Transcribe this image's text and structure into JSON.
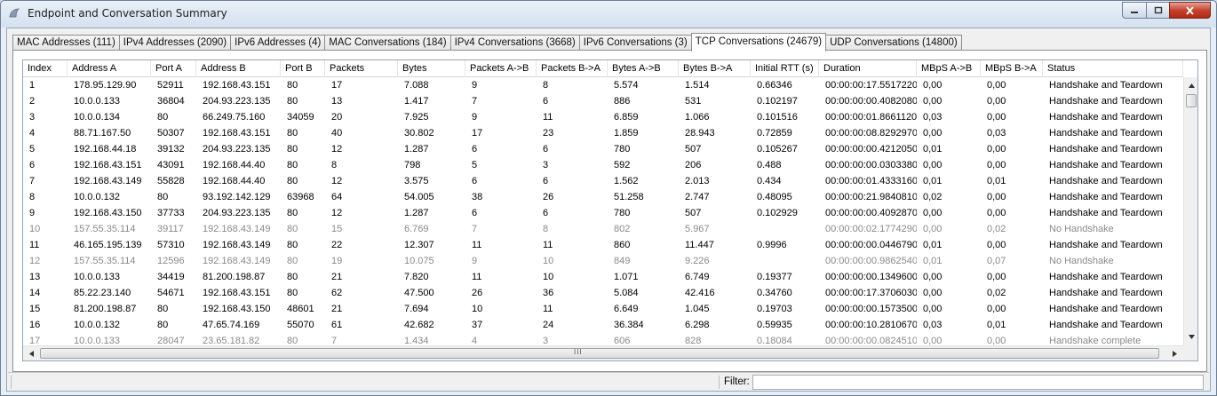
{
  "window": {
    "title": "Endpoint and Conversation Summary"
  },
  "tabs": [
    {
      "label": "MAC Addresses (111)",
      "w": 118
    },
    {
      "label": "IPv4 Addresses (2090)",
      "w": 124
    },
    {
      "label": "IPv6 Addresses (4)",
      "w": 102
    },
    {
      "label": "MAC Conversations (184)",
      "w": 136
    },
    {
      "label": "IPv4 Conversations (3668)",
      "w": 141
    },
    {
      "label": "IPv6 Conversations (3)",
      "w": 123
    },
    {
      "label": "TCP Conversations (24679)",
      "w": 148,
      "active": true
    },
    {
      "label": "UDP Conversations (14800)",
      "w": 140
    }
  ],
  "table": {
    "columns": [
      "Index",
      "Address A",
      "Port A",
      "Address B",
      "Port B",
      "Packets",
      "Bytes",
      "Packets A->B",
      "Packets B->A",
      "Bytes A->B",
      "Bytes B->A",
      "Initial RTT (s)",
      "Duration",
      "MBpS A->B",
      "MBpS B->A",
      "Status"
    ],
    "rows": [
      {
        "cells": [
          "1",
          "178.95.129.90",
          "52911",
          "192.168.43.151",
          "80",
          "17",
          "7.088",
          "9",
          "8",
          "5.574",
          "1.514",
          "0.66346",
          "00:00:00:17.551722000",
          "0,00",
          "0,00",
          "Handshake and Teardown"
        ]
      },
      {
        "cells": [
          "2",
          "10.0.0.133",
          "36804",
          "204.93.223.135",
          "80",
          "13",
          "1.417",
          "7",
          "6",
          "886",
          "531",
          "0.102197",
          "00:00:00:00.408208000",
          "0,00",
          "0,00",
          "Handshake and Teardown"
        ]
      },
      {
        "cells": [
          "3",
          "10.0.0.134",
          "80",
          "66.249.75.160",
          "34059",
          "20",
          "7.925",
          "9",
          "11",
          "6.859",
          "1.066",
          "0.101516",
          "00:00:00:01.866112000",
          "0,03",
          "0,00",
          "Handshake and Teardown"
        ]
      },
      {
        "cells": [
          "4",
          "88.71.167.50",
          "50307",
          "192.168.43.151",
          "80",
          "40",
          "30.802",
          "17",
          "23",
          "1.859",
          "28.943",
          "0.72859",
          "00:00:00:08.829297000",
          "0,00",
          "0,03",
          "Handshake and Teardown"
        ]
      },
      {
        "cells": [
          "5",
          "192.168.44.18",
          "39132",
          "204.93.223.135",
          "80",
          "12",
          "1.287",
          "6",
          "6",
          "780",
          "507",
          "0.105267",
          "00:00:00:00.421205000",
          "0,01",
          "0,00",
          "Handshake and Teardown"
        ]
      },
      {
        "cells": [
          "6",
          "192.168.43.151",
          "43091",
          "192.168.44.40",
          "80",
          "8",
          "798",
          "5",
          "3",
          "592",
          "206",
          "0.488",
          "00:00:00:00.030338000",
          "0,00",
          "0,00",
          "Handshake and Teardown"
        ]
      },
      {
        "cells": [
          "7",
          "192.168.43.149",
          "55828",
          "192.168.44.40",
          "80",
          "12",
          "3.575",
          "6",
          "6",
          "1.562",
          "2.013",
          "0.434",
          "00:00:00:01.433316000",
          "0,01",
          "0,01",
          "Handshake and Teardown"
        ]
      },
      {
        "cells": [
          "8",
          "10.0.0.132",
          "80",
          "93.192.142.129",
          "63968",
          "64",
          "54.005",
          "38",
          "26",
          "51.258",
          "2.747",
          "0.48095",
          "00:00:00:21.984081000",
          "0,02",
          "0,00",
          "Handshake and Teardown"
        ]
      },
      {
        "cells": [
          "9",
          "192.168.43.150",
          "37733",
          "204.93.223.135",
          "80",
          "12",
          "1.287",
          "6",
          "6",
          "780",
          "507",
          "0.102929",
          "00:00:00:00.409287000",
          "0,00",
          "0,00",
          "Handshake and Teardown"
        ]
      },
      {
        "dim": true,
        "cells": [
          "10",
          "157.55.35.114",
          "39117",
          "192.168.43.149",
          "80",
          "15",
          "6.769",
          "7",
          "8",
          "802",
          "5.967",
          "",
          "00:00:00:02.177429000",
          "0,00",
          "0,02",
          "No Handshake"
        ]
      },
      {
        "cells": [
          "11",
          "46.165.195.139",
          "57310",
          "192.168.43.149",
          "80",
          "22",
          "12.307",
          "11",
          "11",
          "860",
          "11.447",
          "0.9996",
          "00:00:00:00.044679000",
          "0,01",
          "0,00",
          "Handshake and Teardown"
        ]
      },
      {
        "dim": true,
        "cells": [
          "12",
          "157.55.35.114",
          "12596",
          "192.168.43.149",
          "80",
          "19",
          "10.075",
          "9",
          "10",
          "849",
          "9.226",
          "",
          "00:00:00:00.986254000",
          "0,01",
          "0,07",
          "No Handshake"
        ]
      },
      {
        "cells": [
          "13",
          "10.0.0.133",
          "34419",
          "81.200.198.87",
          "80",
          "21",
          "7.820",
          "11",
          "10",
          "1.071",
          "6.749",
          "0.19377",
          "00:00:00:00.134960000",
          "0,00",
          "0,00",
          "Handshake and Teardown"
        ]
      },
      {
        "cells": [
          "14",
          "85.22.23.140",
          "54671",
          "192.168.43.151",
          "80",
          "62",
          "47.500",
          "26",
          "36",
          "5.084",
          "42.416",
          "0.34760",
          "00:00:00:17.370603000",
          "0,00",
          "0,02",
          "Handshake and Teardown"
        ]
      },
      {
        "cells": [
          "15",
          "81.200.198.87",
          "80",
          "192.168.43.150",
          "48601",
          "21",
          "7.694",
          "10",
          "11",
          "6.649",
          "1.045",
          "0.19703",
          "00:00:00:00.157350000",
          "0,00",
          "0,00",
          "Handshake and Teardown"
        ]
      },
      {
        "cells": [
          "16",
          "10.0.0.132",
          "80",
          "47.65.74.169",
          "55070",
          "61",
          "42.682",
          "37",
          "24",
          "36.384",
          "6.298",
          "0.59935",
          "00:00:00:10.281067000",
          "0,03",
          "0,01",
          "Handshake and Teardown"
        ]
      },
      {
        "dim": true,
        "cells": [
          "17",
          "10.0.0.133",
          "28047",
          "23.65.181.82",
          "80",
          "7",
          "1.434",
          "4",
          "3",
          "606",
          "828",
          "0.18084",
          "00:00:00:00.082451000",
          "0,00",
          "0,00",
          "Handshake complete"
        ]
      }
    ]
  },
  "scrollbar": {
    "h_grip": "III"
  },
  "status": {
    "filter_label": "Filter:",
    "filter_value": ""
  }
}
